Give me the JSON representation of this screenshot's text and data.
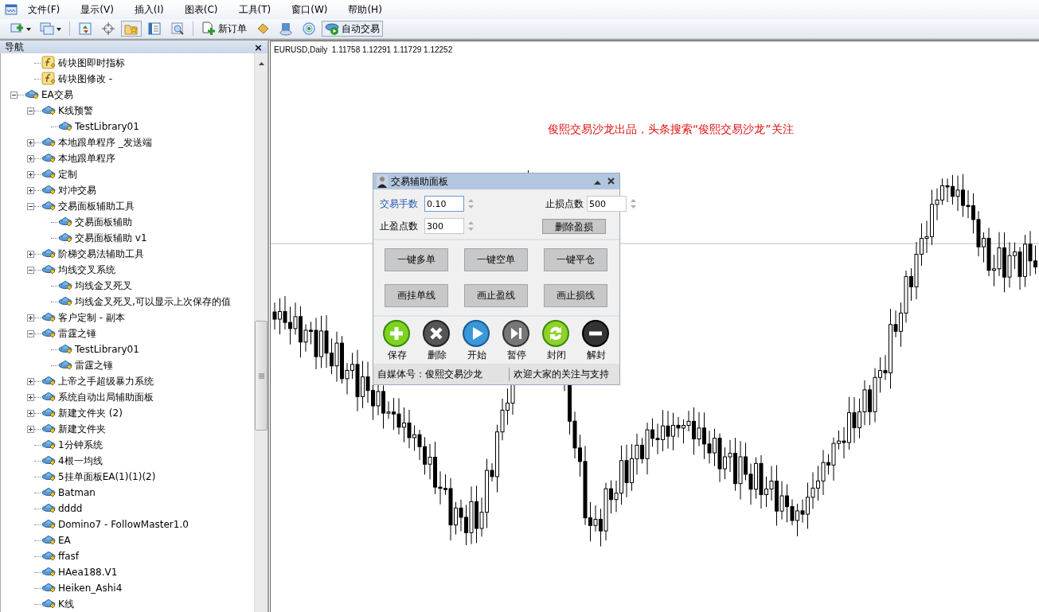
{
  "menu": [
    "文件(F)",
    "显示(V)",
    "插入(I)",
    "图表(C)",
    "工具(T)",
    "窗口(W)",
    "帮助(H)"
  ],
  "toolbar": [
    {
      "kind": "dropdown"
    },
    {
      "kind": "dropdown"
    },
    {
      "kind": "separator"
    },
    {
      "kind": "icon"
    },
    {
      "kind": "icon"
    },
    {
      "kind": "icon",
      "on": true
    },
    {
      "kind": "icon"
    },
    {
      "kind": "icon"
    },
    {
      "kind": "separator"
    },
    {
      "kind": "text",
      "label": "新订单"
    },
    {
      "kind": "icon"
    },
    {
      "kind": "icon"
    },
    {
      "kind": "icon"
    },
    {
      "kind": "text",
      "label": "自动交易",
      "on": true
    }
  ],
  "navigator": {
    "title": "导航",
    "close": "×",
    "scrolled_items": [
      {
        "label": "砖块图即时指标",
        "kind": "indicator"
      },
      {
        "label": "砖块图修改 -",
        "kind": "indicator"
      }
    ],
    "items": [
      {
        "label": "EA交易",
        "kind": "expert",
        "expanded": true,
        "children": [
          {
            "label": "K线预警",
            "kind": "expert",
            "expanded": true,
            "children": [
              {
                "label": "TestLibrary01",
                "kind": "expert"
              }
            ]
          },
          {
            "label": "本地跟单程序 _发送端",
            "kind": "expert",
            "expanded": false
          },
          {
            "label": "本地跟单程序",
            "kind": "expert",
            "expanded": false
          },
          {
            "label": "定制",
            "kind": "expert",
            "expanded": false
          },
          {
            "label": "对冲交易",
            "kind": "expert",
            "expanded": false
          },
          {
            "label": "交易面板辅助工具",
            "kind": "expert",
            "expanded": true,
            "children": [
              {
                "label": "交易面板辅助",
                "kind": "expert"
              },
              {
                "label": "交易面板辅助 v1",
                "kind": "expert"
              }
            ]
          },
          {
            "label": "阶梯交易法辅助工具",
            "kind": "expert",
            "expanded": false
          },
          {
            "label": "均线交叉系统",
            "kind": "expert",
            "expanded": true,
            "children": [
              {
                "label": "均线金叉死叉",
                "kind": "expert"
              },
              {
                "label": "均线金叉死叉,可以显示上次保存的值",
                "kind": "expert"
              }
            ]
          },
          {
            "label": "客户定制 - 副本",
            "kind": "expert",
            "expanded": false
          },
          {
            "label": "雷霆之锤",
            "kind": "expert",
            "expanded": true,
            "children": [
              {
                "label": "TestLibrary01",
                "kind": "expert"
              },
              {
                "label": "雷霆之锤",
                "kind": "expert"
              }
            ]
          },
          {
            "label": "上帝之手超级暴力系统",
            "kind": "expert",
            "expanded": false
          },
          {
            "label": "系统自动出局辅助面板",
            "kind": "expert",
            "expanded": false
          },
          {
            "label": "新建文件夹 (2)",
            "kind": "expert",
            "expanded": false
          },
          {
            "label": "新建文件夹",
            "kind": "expert",
            "expanded": false
          },
          {
            "label": "1分钟系统",
            "kind": "expert"
          },
          {
            "label": "4根一均线",
            "kind": "expert"
          },
          {
            "label": "5挂单面板EA(1)(1)(2)",
            "kind": "expert"
          },
          {
            "label": "Batman",
            "kind": "expert"
          },
          {
            "label": "dddd",
            "kind": "expert"
          },
          {
            "label": "Domino7 - FollowMaster1.0",
            "kind": "expert"
          },
          {
            "label": "EA",
            "kind": "expert"
          },
          {
            "label": "ffasf",
            "kind": "expert"
          },
          {
            "label": "HAea188.V1",
            "kind": "expert"
          },
          {
            "label": "Heiken_Ashi4",
            "kind": "expert"
          },
          {
            "label": "K线",
            "kind": "expert"
          }
        ]
      }
    ]
  },
  "chart": {
    "header": "EURUSD,Daily  1.11758 1.12291 1.11729 1.12252",
    "annotation": "俊熙交易沙龙出品，头条搜索“俊熙交易沙龙”关注"
  },
  "panel": {
    "title": "交易辅助面板",
    "fields": [
      {
        "label": "交易手数",
        "value": "0.10",
        "focused": true
      },
      {
        "label": "止损点数",
        "value": "500",
        "focused": false
      },
      {
        "label": "止盈点数",
        "value": "300",
        "focused": false
      }
    ],
    "delete_button": "删除盈损",
    "buttons": [
      "一键多单",
      "一键空单",
      "一键平仓",
      "画挂单线",
      "画止盈线",
      "画止损线"
    ],
    "actions": [
      {
        "label": "保存",
        "kind": "add"
      },
      {
        "label": "删除",
        "kind": "remove"
      },
      {
        "label": "开始",
        "kind": "play"
      },
      {
        "label": "暂停",
        "kind": "pause"
      },
      {
        "label": "封闭",
        "kind": "refresh"
      },
      {
        "label": "解封",
        "kind": "minus"
      }
    ],
    "footer": [
      "自媒体号：俊熙交易沙龙",
      "欢迎大家的关注与支持"
    ]
  }
}
